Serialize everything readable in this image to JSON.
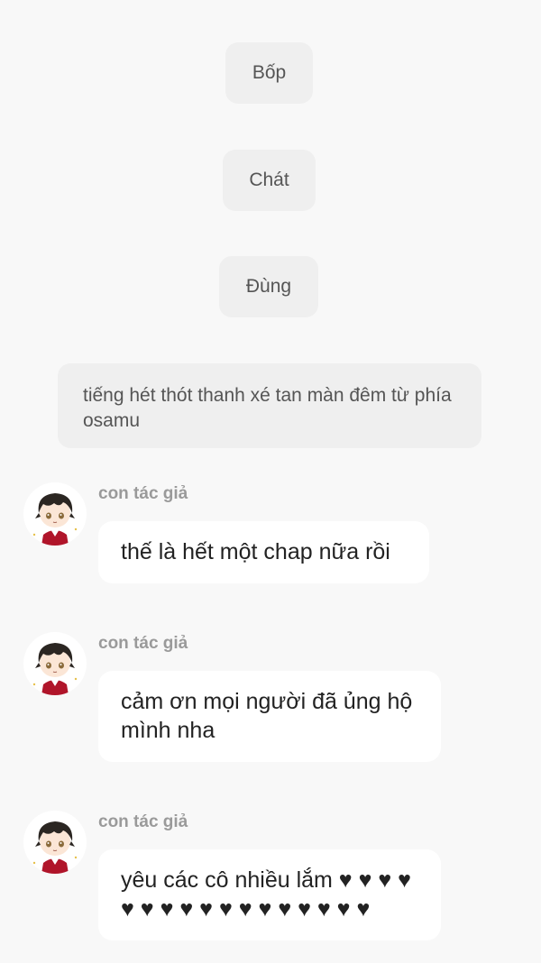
{
  "system_messages": [
    "Bốp",
    "Chát",
    "Đùng"
  ],
  "narration": "tiếng hét thót thanh xé tan màn đêm từ phía osamu",
  "messages": [
    {
      "author": "con tác giả",
      "text": "thế là hết một chap nữa rồi"
    },
    {
      "author": "con tác giả",
      "text": "cảm ơn mọi người đã ủng hộ mình nha"
    },
    {
      "author": "con tác giả",
      "text": "yêu các cô nhiều lắm ♥ ♥ ♥ ♥ ♥ ♥ ♥ ♥ ♥ ♥ ♥ ♥ ♥ ♥ ♥ ♥ ♥"
    }
  ],
  "colors": {
    "background": "#f8f8f8",
    "system_bubble": "#efefef",
    "chat_bubble": "#ffffff",
    "author_text": "#9a9a9a",
    "avatar_hair": "#2b2622",
    "avatar_jacket": "#b0152a"
  },
  "icons": {
    "avatar": "chibi-character-avatar-icon"
  }
}
